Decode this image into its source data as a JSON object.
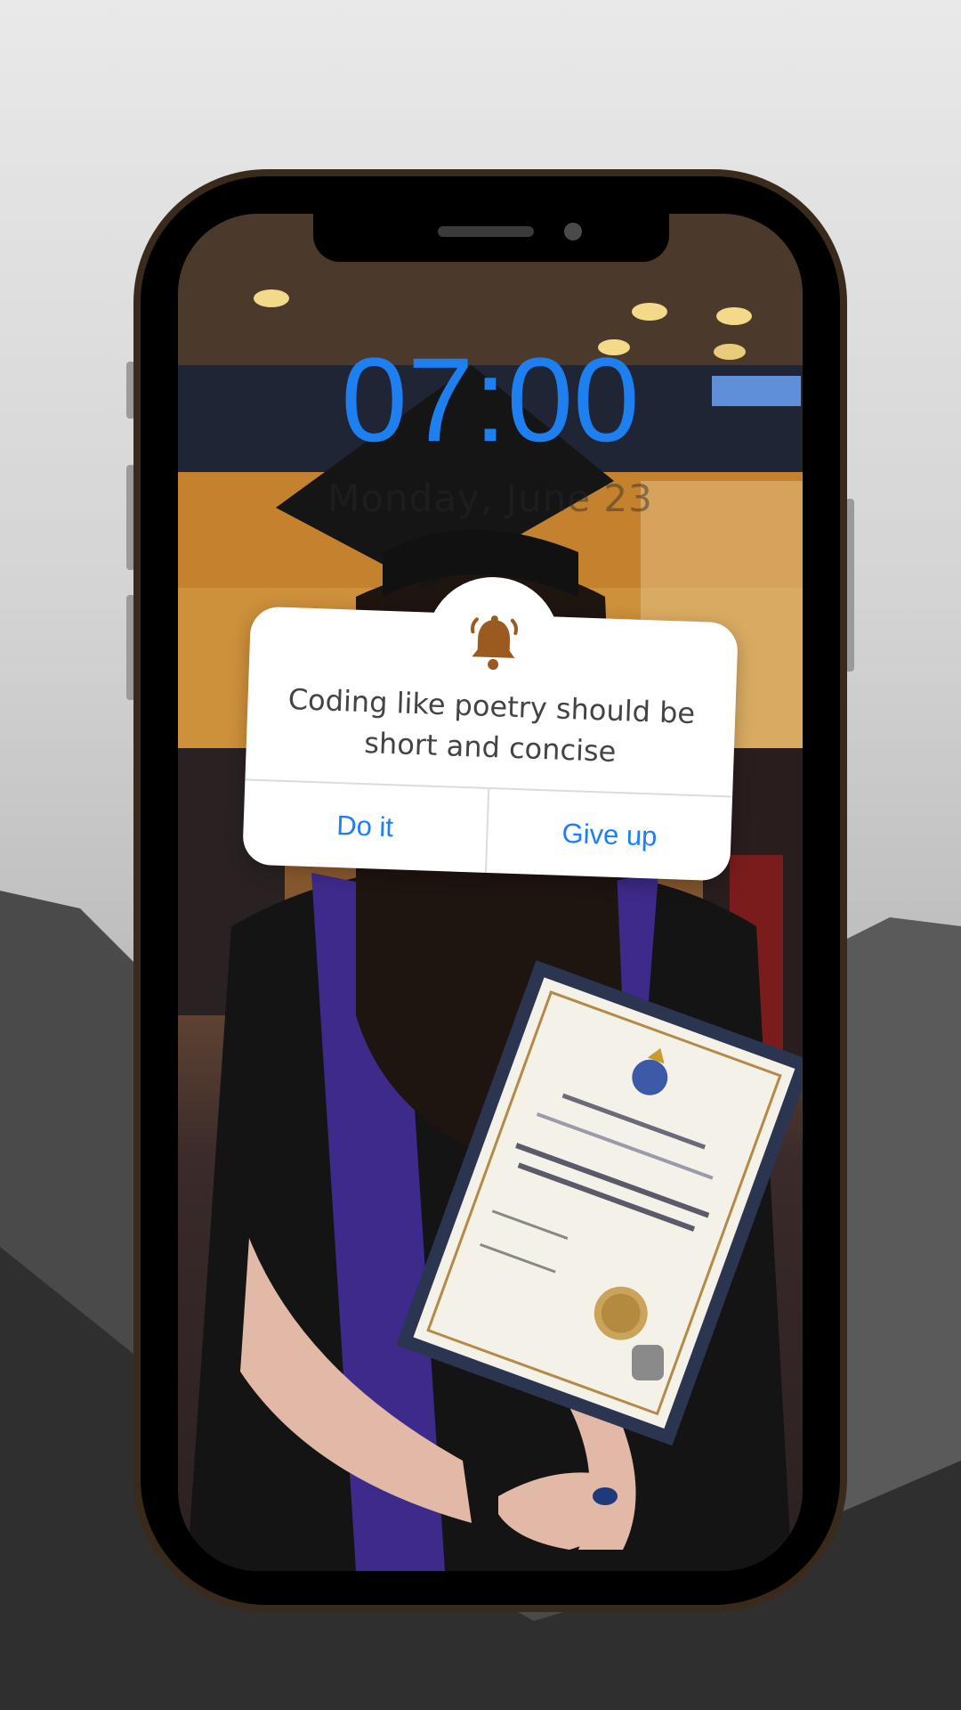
{
  "lockscreen": {
    "time": "07:00",
    "date": "Monday, June 23"
  },
  "notification": {
    "icon": "bell-icon",
    "message": "Coding like poetry should be short and concise",
    "actions": {
      "primary_label": "Do it",
      "secondary_label": "Give up"
    }
  },
  "colors": {
    "accent": "#1e7ff0",
    "bell": "#9a5a20",
    "phone_frame": "#3a2a1c"
  }
}
